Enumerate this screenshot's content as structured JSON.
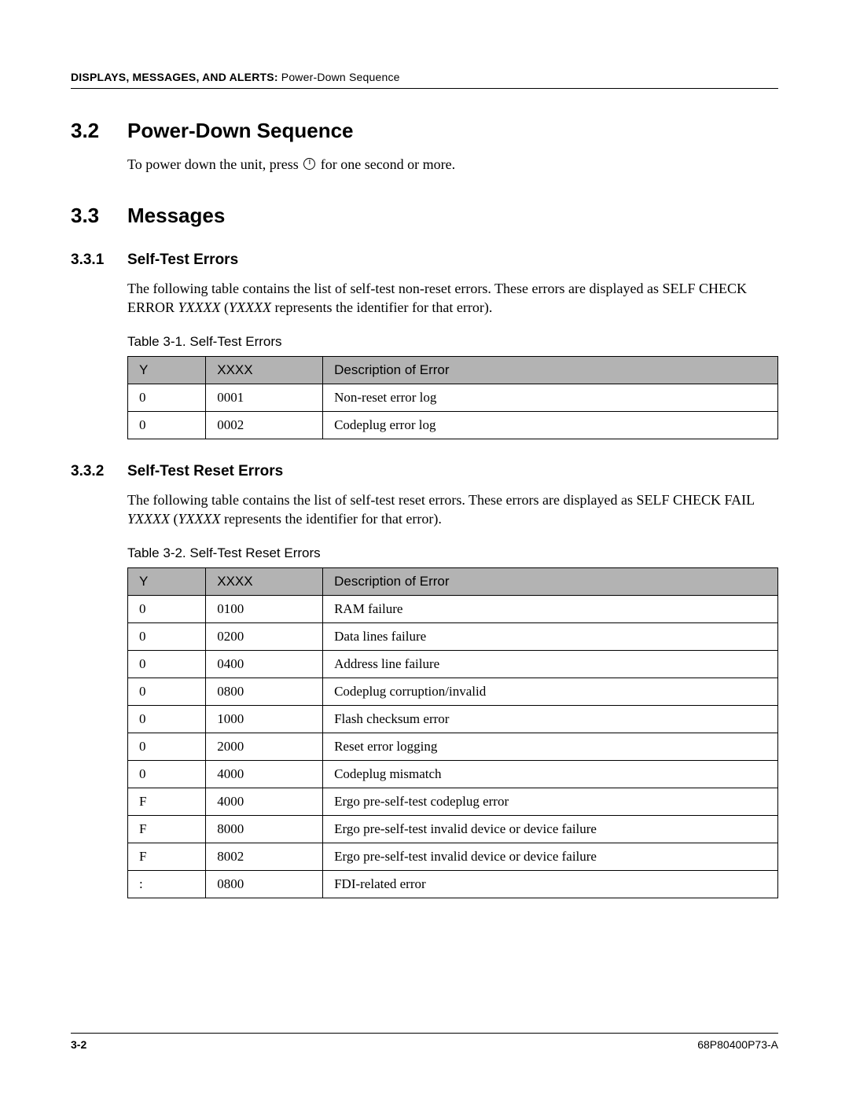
{
  "header": {
    "bold": "DISPLAYS, MESSAGES, AND ALERTS:",
    "rest": " Power-Down Sequence"
  },
  "sec32": {
    "num": "3.2",
    "title": "Power-Down Sequence",
    "text_before": "To power down the unit, press ",
    "text_after": " for one second or more."
  },
  "sec33": {
    "num": "3.3",
    "title": "Messages"
  },
  "sec331": {
    "num": "3.3.1",
    "title": "Self-Test Errors",
    "para_a": "The following table contains the list of self-test non-reset errors. These errors are displayed as SELF CHECK ERROR ",
    "para_italic1": "YXXXX",
    "para_mid": " (",
    "para_italic2": "YXXXX",
    "para_b": " represents the identifier for that error)."
  },
  "table1": {
    "caption": "Table 3-1. Self-Test Errors",
    "headers": {
      "y": "Y",
      "x": "XXXX",
      "d": "Description of Error"
    },
    "rows": [
      {
        "y": "0",
        "x": "0001",
        "d": "Non-reset error log"
      },
      {
        "y": "0",
        "x": "0002",
        "d": "Codeplug error log"
      }
    ]
  },
  "sec332": {
    "num": "3.3.2",
    "title": "Self-Test Reset Errors",
    "para_a": "The following table contains the list of self-test reset errors. These errors are displayed as SELF CHECK FAIL ",
    "para_italic1": "YXXXX",
    "para_mid": " (",
    "para_italic2": "YXXXX",
    "para_b": " represents the identifier for that error)."
  },
  "table2": {
    "caption": "Table 3-2. Self-Test Reset Errors",
    "headers": {
      "y": "Y",
      "x": "XXXX",
      "d": "Description of Error"
    },
    "rows": [
      {
        "y": "0",
        "x": "0100",
        "d": "RAM failure"
      },
      {
        "y": "0",
        "x": "0200",
        "d": "Data lines failure"
      },
      {
        "y": "0",
        "x": "0400",
        "d": "Address line failure"
      },
      {
        "y": "0",
        "x": "0800",
        "d": "Codeplug corruption/invalid"
      },
      {
        "y": "0",
        "x": "1000",
        "d": "Flash checksum error"
      },
      {
        "y": "0",
        "x": "2000",
        "d": "Reset error logging"
      },
      {
        "y": "0",
        "x": "4000",
        "d": "Codeplug mismatch"
      },
      {
        "y": "F",
        "x": "4000",
        "d": "Ergo pre-self-test codeplug error"
      },
      {
        "y": "F",
        "x": "8000",
        "d": "Ergo pre-self-test invalid device or device failure"
      },
      {
        "y": "F",
        "x": "8002",
        "d": "Ergo pre-self-test invalid device or device failure"
      },
      {
        "y": ":",
        "x": "0800",
        "d": "FDI-related error"
      }
    ]
  },
  "footer": {
    "page": "3-2",
    "doc": "68P80400P73-A"
  }
}
